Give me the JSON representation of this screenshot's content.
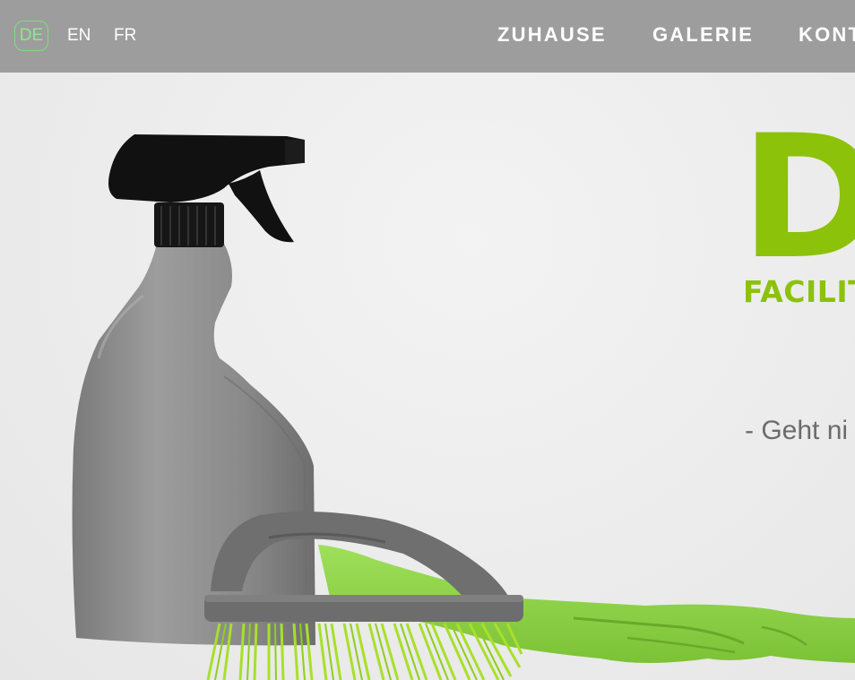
{
  "languages": [
    "DE",
    "EN",
    "FR"
  ],
  "active_language": "DE",
  "nav": {
    "home": "ZUHAUSE",
    "gallery": "GALERIE",
    "contact": "KONT"
  },
  "hero": {
    "brand_letter": "D",
    "brand_sub": "FACILITY",
    "tagline": "- Geht ni"
  },
  "colors": {
    "accent": "#8cc20a",
    "topbar": "#9a9a9a",
    "active_lang_border": "#7be07b"
  }
}
